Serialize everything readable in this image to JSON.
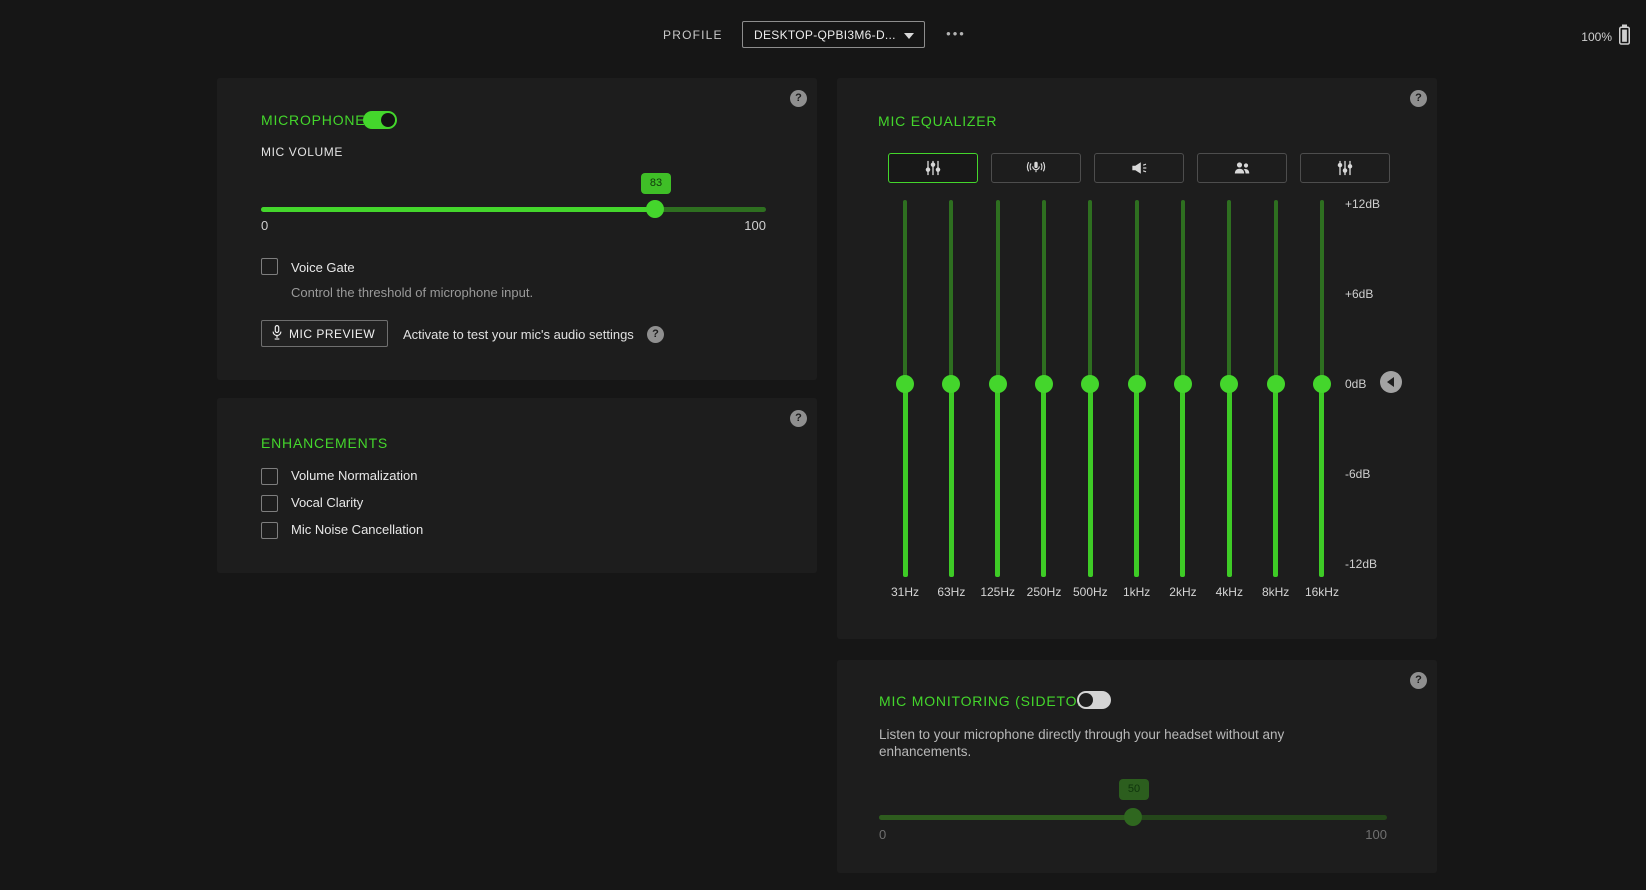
{
  "topbar": {
    "profile_label": "PROFILE",
    "profile_value": "DESKTOP-QPBI3M6-D...",
    "more_button": "•••",
    "battery_percent": "100%"
  },
  "panels": {
    "microphone": {
      "title": "MICROPHONE",
      "enabled": true,
      "volume": {
        "label": "MIC VOLUME",
        "value": 83,
        "min_label": "0",
        "max_label": "100"
      },
      "voice_gate": {
        "label": "Voice Gate",
        "checked": false,
        "description": "Control the threshold of microphone input."
      },
      "mic_preview": {
        "button_label": "MIC PREVIEW",
        "hint": "Activate to test your mic's audio settings"
      }
    },
    "enhancements": {
      "title": "ENHANCEMENTS",
      "options": [
        {
          "label": "Volume Normalization",
          "checked": false
        },
        {
          "label": "Vocal Clarity",
          "checked": false
        },
        {
          "label": "Mic Noise Cancellation",
          "checked": false
        }
      ]
    },
    "mic_equalizer": {
      "title": "MIC EQUALIZER",
      "tabs": [
        {
          "name": "equalizer",
          "active": true
        },
        {
          "name": "mic-broadcast",
          "active": false
        },
        {
          "name": "megaphone",
          "active": false
        },
        {
          "name": "people",
          "active": false
        },
        {
          "name": "sliders",
          "active": false
        }
      ],
      "db_scale_labels": [
        "+12dB",
        "+6dB",
        "0dB",
        "-6dB",
        "-12dB"
      ],
      "db_range": [
        -12,
        12
      ],
      "bands": [
        {
          "freq": "31Hz",
          "gain_db": 0
        },
        {
          "freq": "63Hz",
          "gain_db": 0
        },
        {
          "freq": "125Hz",
          "gain_db": 0
        },
        {
          "freq": "250Hz",
          "gain_db": 0
        },
        {
          "freq": "500Hz",
          "gain_db": 0
        },
        {
          "freq": "1kHz",
          "gain_db": 0
        },
        {
          "freq": "2kHz",
          "gain_db": 0
        },
        {
          "freq": "4kHz",
          "gain_db": 0
        },
        {
          "freq": "8kHz",
          "gain_db": 0
        },
        {
          "freq": "16kHz",
          "gain_db": 0
        }
      ]
    },
    "mic_monitoring": {
      "title": "MIC MONITORING (SIDETONE)",
      "enabled": false,
      "description": "Listen to your microphone directly through your headset without any enhancements.",
      "slider": {
        "value": 50,
        "min_label": "0",
        "max_label": "100"
      }
    }
  },
  "colors": {
    "accent_green": "#44d62c",
    "page_bg": "#161616",
    "panel_bg": "#1d1d1d"
  }
}
